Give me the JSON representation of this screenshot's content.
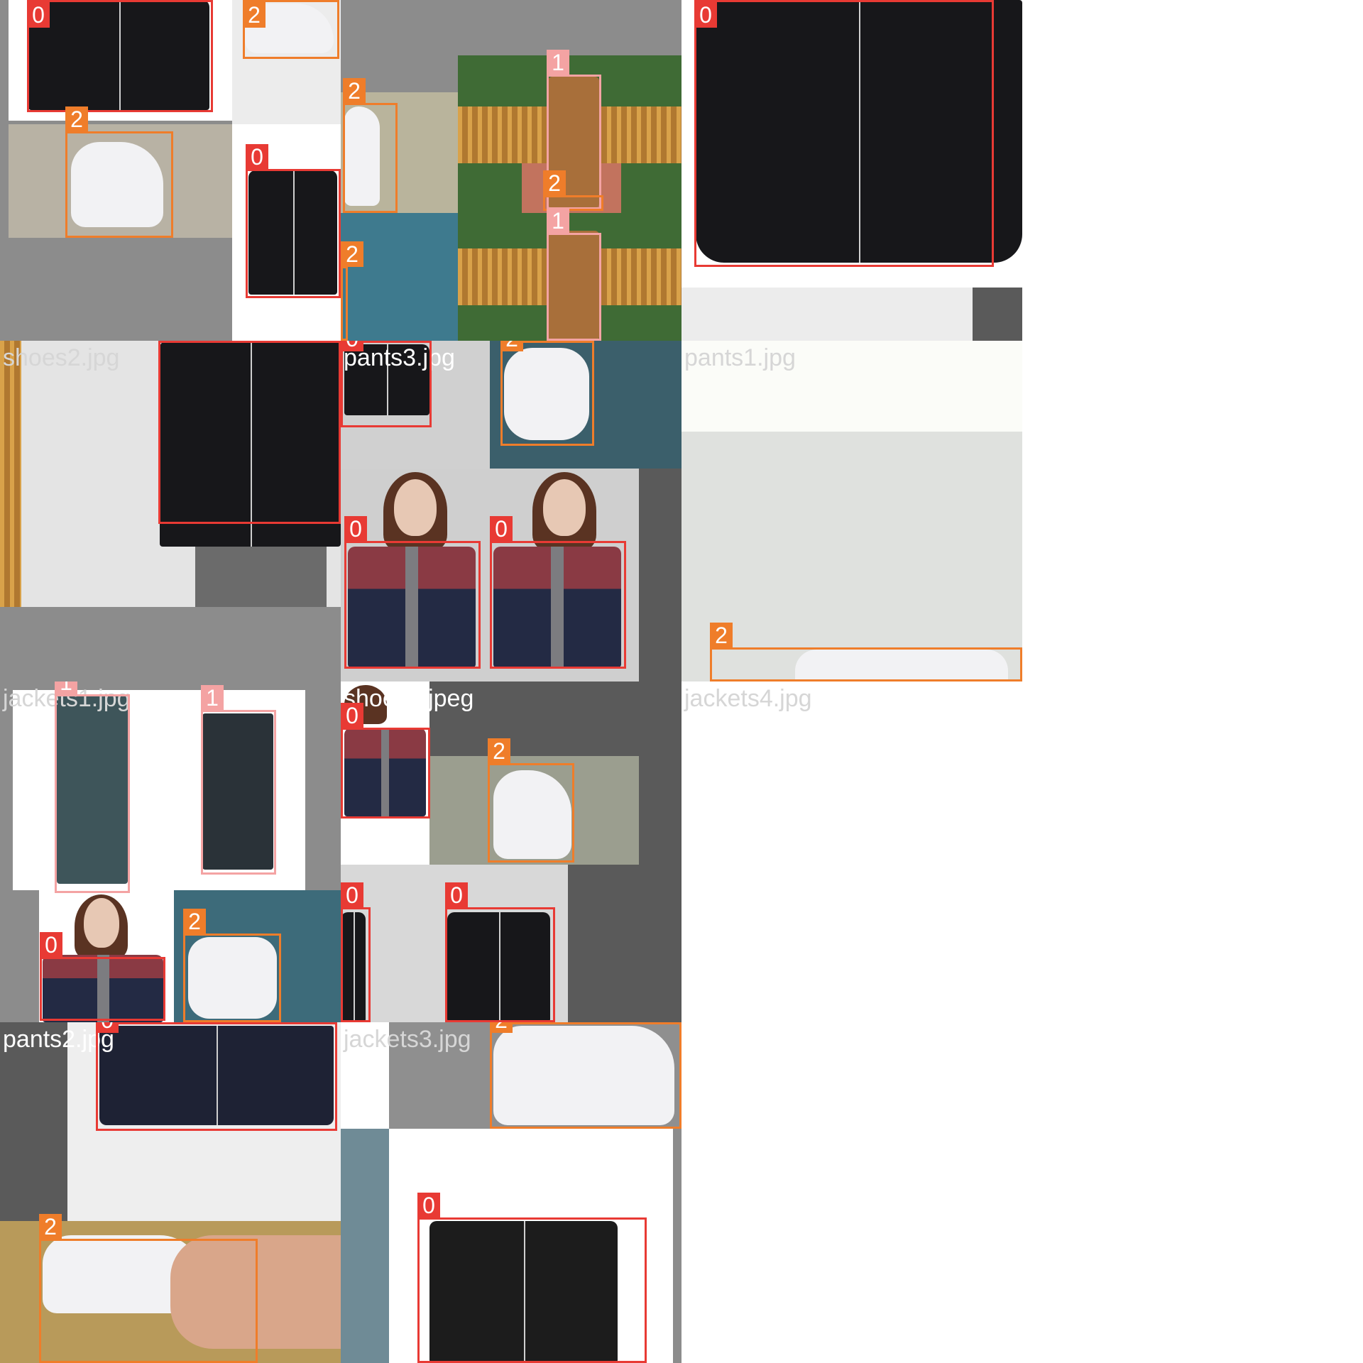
{
  "colors": {
    "jacket_box": "#e83a34",
    "pants_box": "#f4a3a3",
    "shoes_box": "#ef7d2a",
    "filename_light": "#d6d6d6",
    "filename_white": "#ffffff",
    "pad_gray": "#8c8c8c",
    "pad_dark": "#5a5a5a"
  },
  "class_labels": {
    "jacket": "0",
    "pants": "1",
    "shoes": "2"
  },
  "mosaics": [
    {
      "id": "m1",
      "filename": ""
    },
    {
      "id": "m2",
      "filename": ""
    },
    {
      "id": "m3",
      "filename": ""
    },
    {
      "id": "m4",
      "filename": "shoes2.jpg"
    },
    {
      "id": "m5",
      "filename": "pants3.jpg"
    },
    {
      "id": "m6",
      "filename": "pants1.jpg"
    },
    {
      "id": "m7",
      "filename": "jackets1.jpg"
    },
    {
      "id": "m8",
      "filename": "shoes3.jpeg"
    },
    {
      "id": "m9",
      "filename": "jackets4.jpg"
    },
    {
      "id": "m10",
      "filename": "pants2.jpg"
    },
    {
      "id": "m11",
      "filename": "jackets3.jpg"
    }
  ]
}
